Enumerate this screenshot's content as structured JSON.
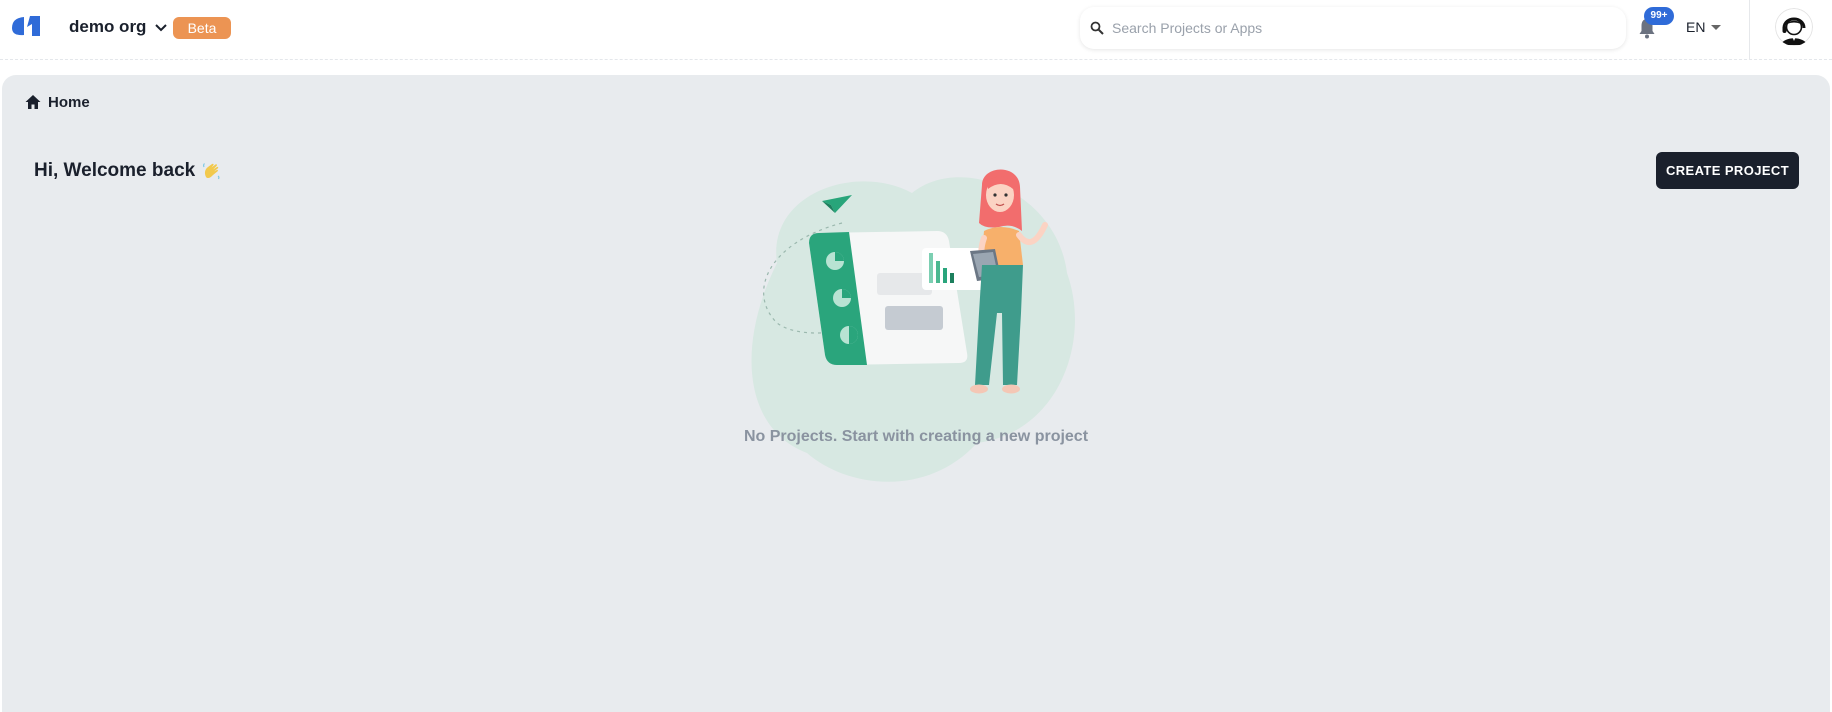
{
  "header": {
    "org_name": "demo org",
    "beta_label": "Beta",
    "search_placeholder": "Search Projects or Apps",
    "notification_count": "99+",
    "language": "EN"
  },
  "breadcrumb": {
    "label": "Home"
  },
  "main": {
    "welcome_text": "Hi, Welcome back",
    "create_button_label": "CREATE PROJECT",
    "empty_state_text": "No Projects. Start with creating a new project"
  },
  "colors": {
    "brand_blue": "#2f6bd8",
    "beta_orange": "#ec9453",
    "panel_bg": "#e8ebee",
    "dark_button": "#1a202c"
  },
  "icons": [
    "logo-icon",
    "chevron-down-icon",
    "search-icon",
    "bell-icon",
    "caret-down-icon",
    "avatar-icon",
    "home-icon",
    "waving-hand-icon"
  ]
}
